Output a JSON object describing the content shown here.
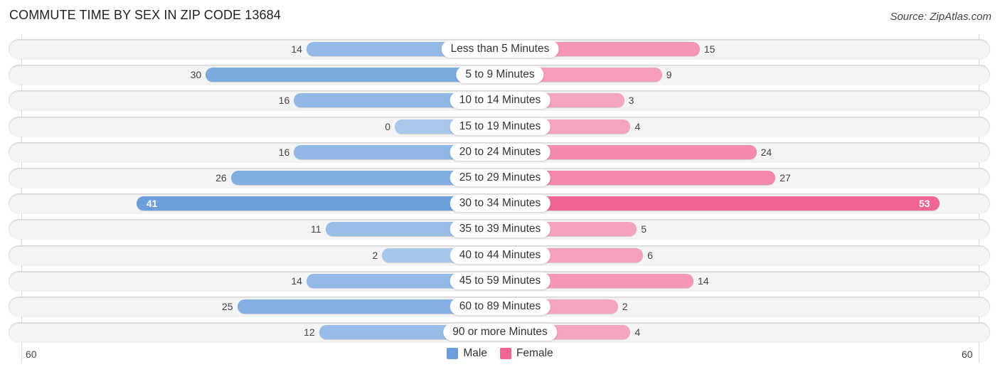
{
  "header": {
    "title": "COMMUTE TIME BY SEX IN ZIP CODE 13684",
    "source": "Source: ZipAtlas.com"
  },
  "colors": {
    "male": "#6a9fdb",
    "male_light": "#a9c8ec",
    "female": "#f06592",
    "female_light": "#f7a8c1"
  },
  "chart_data": {
    "type": "bar",
    "orientation": "horizontal-diverging",
    "title": "COMMUTE TIME BY SEX IN ZIP CODE 13684",
    "categories": [
      "Less than 5 Minutes",
      "5 to 9 Minutes",
      "10 to 14 Minutes",
      "15 to 19 Minutes",
      "20 to 24 Minutes",
      "25 to 29 Minutes",
      "30 to 34 Minutes",
      "35 to 39 Minutes",
      "40 to 44 Minutes",
      "45 to 59 Minutes",
      "60 to 89 Minutes",
      "90 or more Minutes"
    ],
    "series": [
      {
        "name": "Male",
        "values": [
          14,
          30,
          16,
          0,
          16,
          26,
          41,
          11,
          2,
          14,
          25,
          12
        ]
      },
      {
        "name": "Female",
        "values": [
          15,
          9,
          3,
          4,
          24,
          27,
          53,
          5,
          6,
          14,
          2,
          4
        ]
      }
    ],
    "axis": {
      "left_label": "60",
      "right_label": "60",
      "range": [
        -60,
        60
      ]
    },
    "legend": {
      "position": "bottom-center",
      "entries": [
        "Male",
        "Female"
      ]
    },
    "grid": false
  }
}
